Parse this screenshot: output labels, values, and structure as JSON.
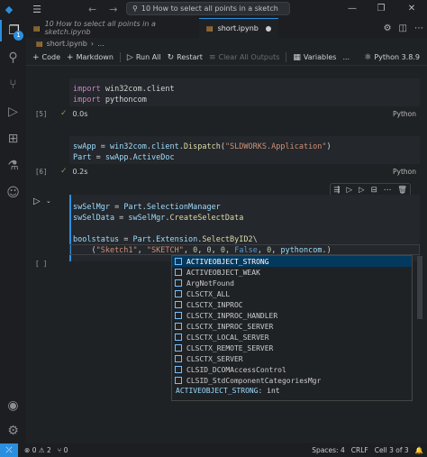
{
  "title": {
    "command_center": "10 How to select all points in a sketch",
    "window": {
      "minimize": "—",
      "restore": "❐",
      "close": "✕"
    }
  },
  "tabs": [
    {
      "label": "10 How to select all points in a sketch.ipynb"
    },
    {
      "label": "short.ipynb"
    }
  ],
  "breadcrumb": {
    "file": "short.ipynb",
    "sep": "›",
    "more": "..."
  },
  "toolbar": {
    "code": "Code",
    "markdown": "Markdown",
    "run_all": "Run All",
    "restart": "Restart",
    "clear_outputs": "Clear All Outputs",
    "variables": "Variables",
    "more": "...",
    "kernel": "Python 3.8.9"
  },
  "cells": {
    "c1": {
      "lines": [
        [
          [
            "kw",
            "import"
          ],
          [
            "op",
            " win32com.client"
          ]
        ],
        [
          [
            "kw",
            "import"
          ],
          [
            "op",
            " pythoncom"
          ]
        ]
      ],
      "exec": "[5]",
      "time": "0.0s",
      "lang": "Python"
    },
    "c2": {
      "lines": [
        [
          [
            "nm",
            "swApp"
          ],
          [
            "op",
            " = "
          ],
          [
            "nm",
            "win32com"
          ],
          [
            "op",
            "."
          ],
          [
            "nm",
            "client"
          ],
          [
            "op",
            "."
          ],
          [
            "fn",
            "Dispatch"
          ],
          [
            "op",
            "("
          ],
          [
            "st",
            "\"SLDWORKS.Application\""
          ],
          [
            "op",
            ")"
          ]
        ],
        [
          [
            "nm",
            "Part"
          ],
          [
            "op",
            " = "
          ],
          [
            "nm",
            "swApp"
          ],
          [
            "op",
            "."
          ],
          [
            "nm",
            "ActiveDoc"
          ]
        ]
      ],
      "exec": "[6]",
      "time": "0.2s",
      "lang": "Python"
    },
    "c3": {
      "lines": [
        [
          [
            "nm",
            "swSelMgr"
          ],
          [
            "op",
            " = "
          ],
          [
            "nm",
            "Part"
          ],
          [
            "op",
            "."
          ],
          [
            "nm",
            "SelectionManager"
          ]
        ],
        [
          [
            "nm",
            "swSelData"
          ],
          [
            "op",
            " = "
          ],
          [
            "nm",
            "swSelMgr"
          ],
          [
            "op",
            "."
          ],
          [
            "fn",
            "CreateSelectData"
          ]
        ],
        [],
        [
          [
            "nm",
            "boolstatus"
          ],
          [
            "op",
            " = "
          ],
          [
            "nm",
            "Part"
          ],
          [
            "op",
            "."
          ],
          [
            "nm",
            "Extension"
          ],
          [
            "op",
            "."
          ],
          [
            "fn",
            "SelectByID2"
          ],
          [
            "op",
            "\\"
          ]
        ],
        [
          [
            "op",
            "    ("
          ],
          [
            "st",
            "\"Sketch1\""
          ],
          [
            "op",
            ", "
          ],
          [
            "st",
            "\"SKETCH\""
          ],
          [
            "op",
            ", "
          ],
          [
            "nu",
            "0"
          ],
          [
            "op",
            ", "
          ],
          [
            "nu",
            "0"
          ],
          [
            "op",
            ", "
          ],
          [
            "nu",
            "0"
          ],
          [
            "op",
            ", "
          ],
          [
            "bool",
            "False"
          ],
          [
            "op",
            ", "
          ],
          [
            "nu",
            "0"
          ],
          [
            "op",
            ", "
          ],
          [
            "nm",
            "pythoncom"
          ],
          [
            "op",
            ".)"
          ]
        ]
      ],
      "exec": "[ ]"
    }
  },
  "suggest": {
    "items": [
      "ACTIVEOBJECT_STRONG",
      "ACTIVEOBJECT_WEAK",
      "ArgNotFound",
      "CLSCTX_ALL",
      "CLSCTX_INPROC",
      "CLSCTX_INPROC_HANDLER",
      "CLSCTX_INPROC_SERVER",
      "CLSCTX_LOCAL_SERVER",
      "CLSCTX_REMOTE_SERVER",
      "CLSCTX_SERVER",
      "CLSID_DCOMAccessControl",
      "CLSID_StdComponentCategoriesMgr"
    ],
    "detail_name": "ACTIVEOBJECT_STRONG",
    "detail_type": ": int"
  },
  "statusbar": {
    "errors": "0",
    "warnings": "2",
    "ports": "0",
    "spaces": "Spaces: 4",
    "eol": "CRLF",
    "cell": "Cell 3 of 3"
  },
  "activity_badge": "1",
  "colors": {
    "accent": "#2b8fe0",
    "selection": "#04395e",
    "success": "#6aa84f"
  }
}
